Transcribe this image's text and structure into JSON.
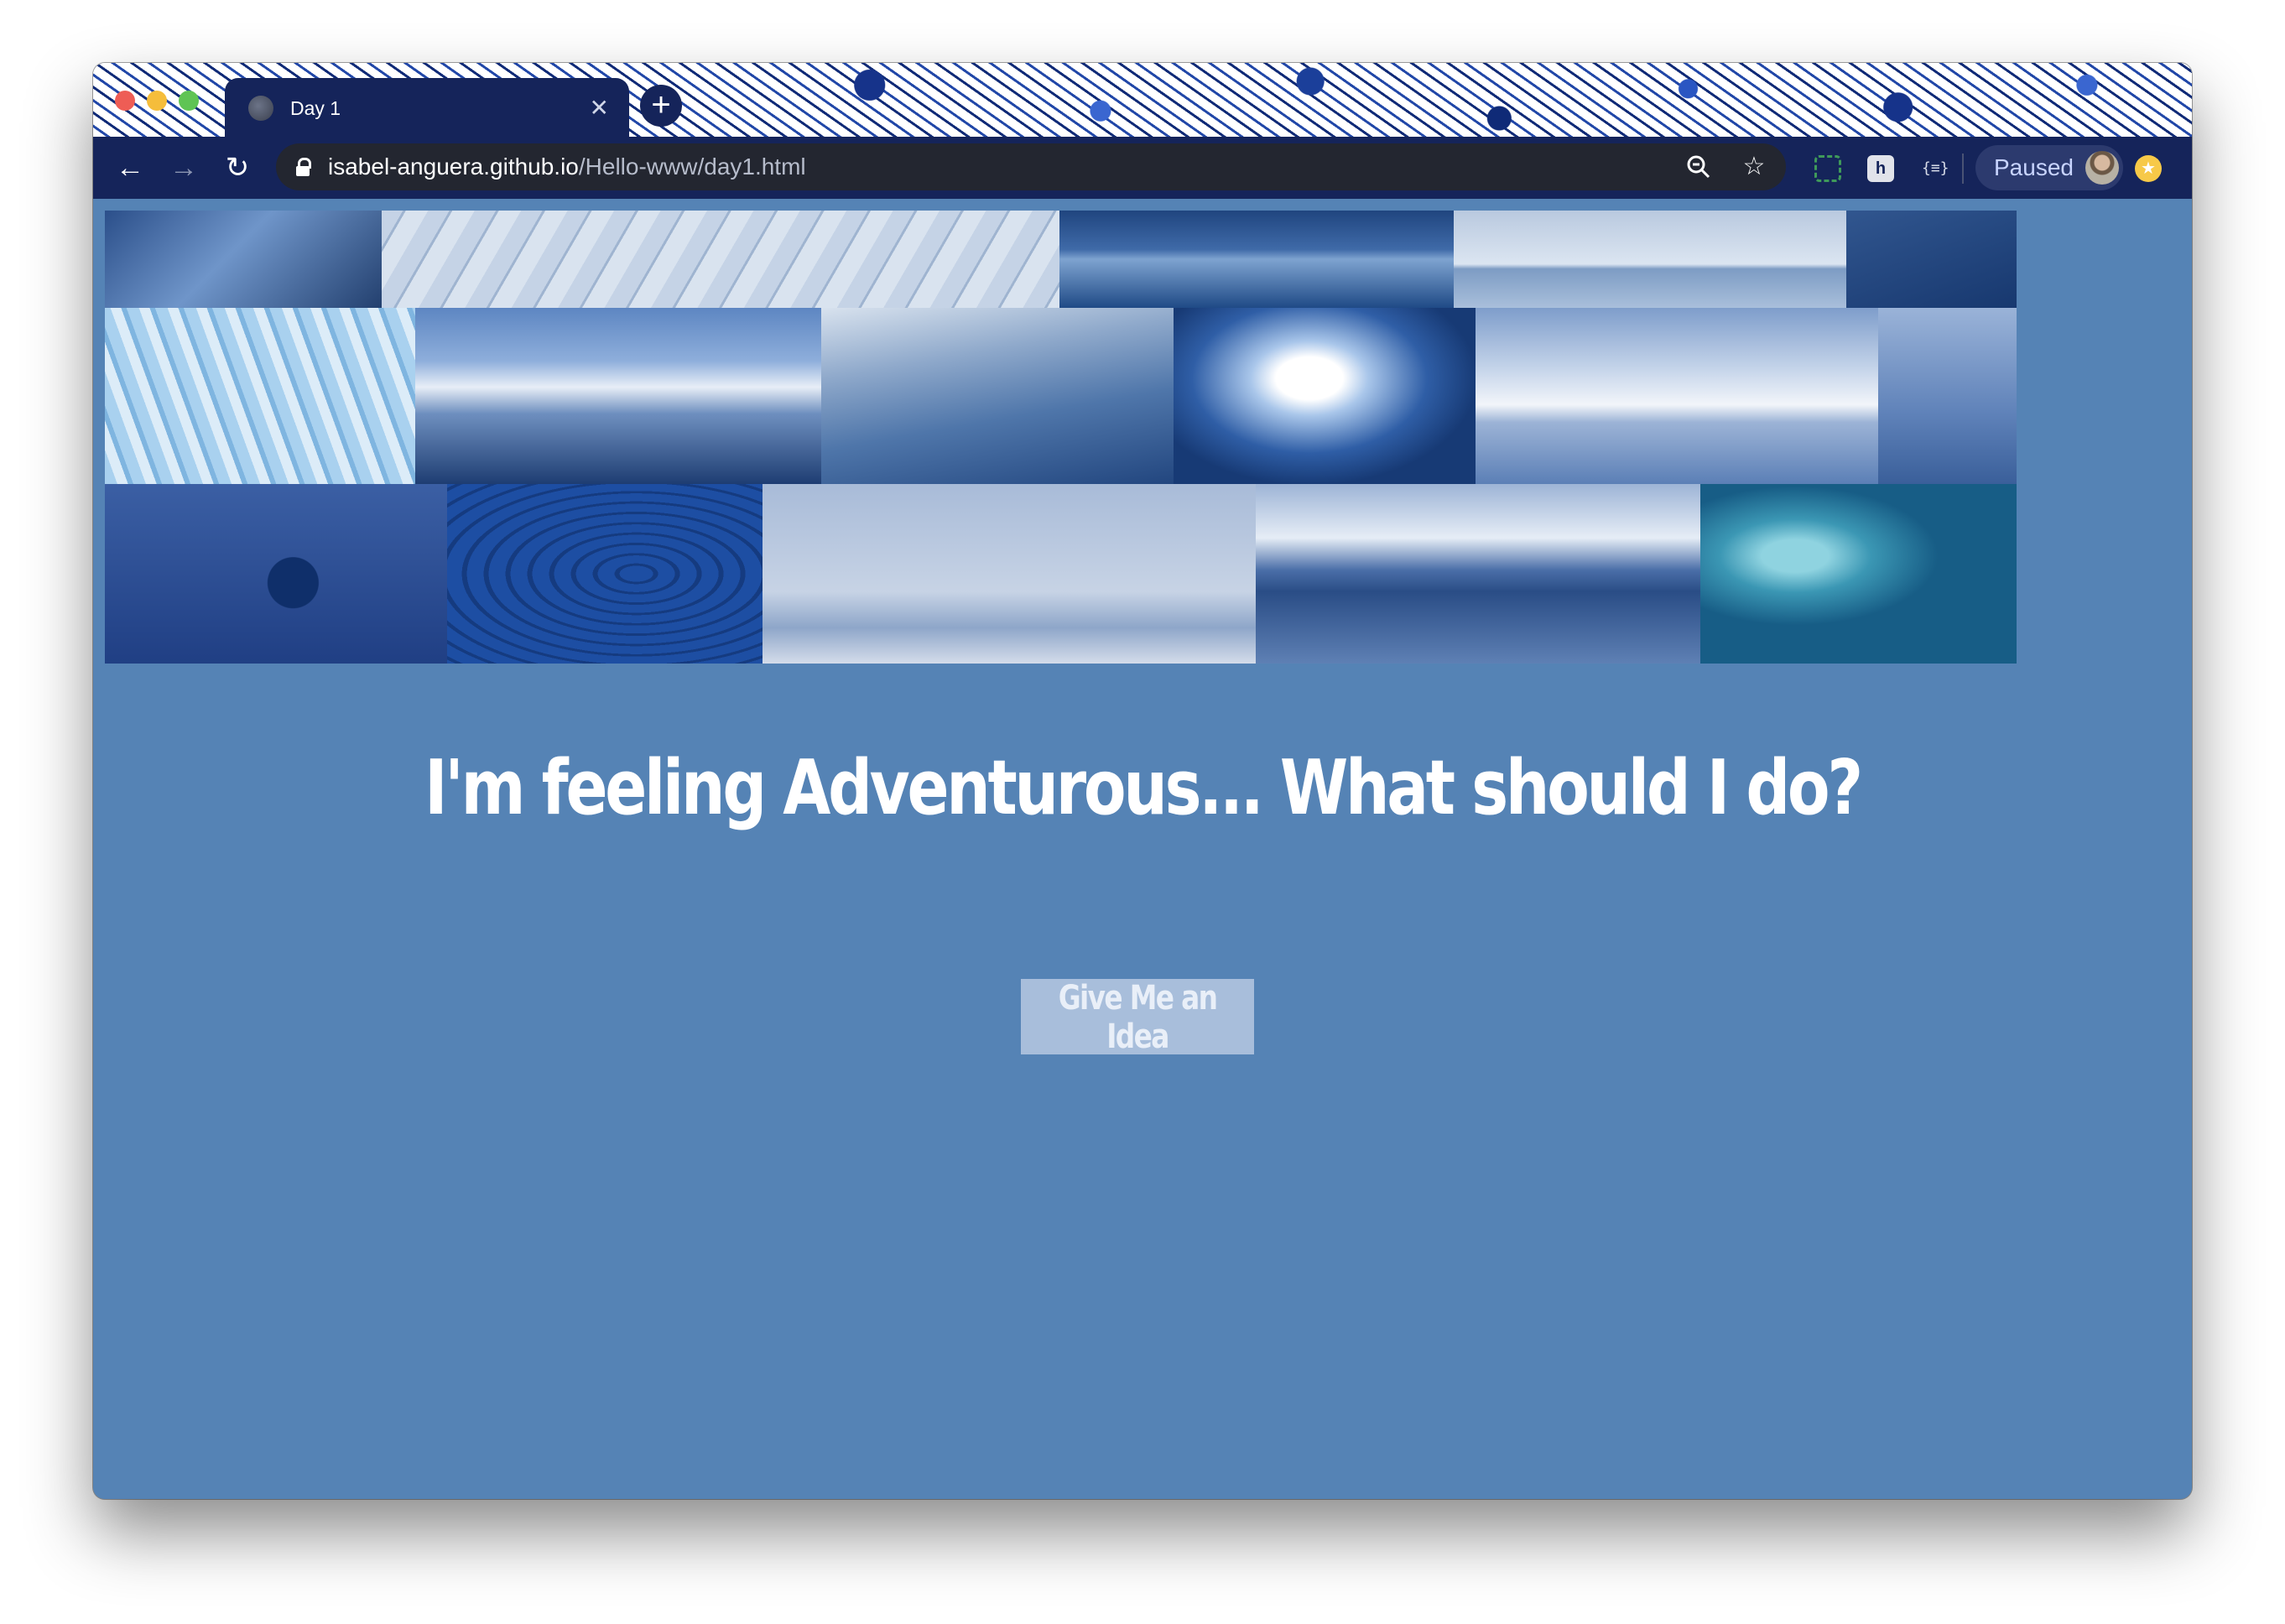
{
  "browser": {
    "tab_title": "Day 1",
    "tab_close_icon": "close-icon",
    "new_tab_icon": "plus-icon",
    "url_host": "isabel-anguera.github.io",
    "url_path": "/Hello-www/day1.html",
    "profile_label": "Paused",
    "extension_3_label": "{≡}",
    "extension_2_label": "h"
  },
  "page": {
    "headline": "I'm feeling Adventurous... What should I do?",
    "button_label": "Give Me an Idea",
    "background_color": "#5583b5",
    "button_color": "#a8bedb"
  },
  "collage": {
    "images": [
      "ice-cave-wall",
      "cracked-ice-surface",
      "mountain-lake-reflection",
      "glacier-lake",
      "dark-blue-water",
      "blue-crevassed-glacier",
      "snowy-mountain-peak",
      "frozen-glacier-valley",
      "ice-cave-person",
      "bled-island-church",
      "misty-fjord",
      "skydiver",
      "dolphins-underwater",
      "paraglider",
      "whale-tail-mountains",
      "surfer-wave"
    ]
  }
}
